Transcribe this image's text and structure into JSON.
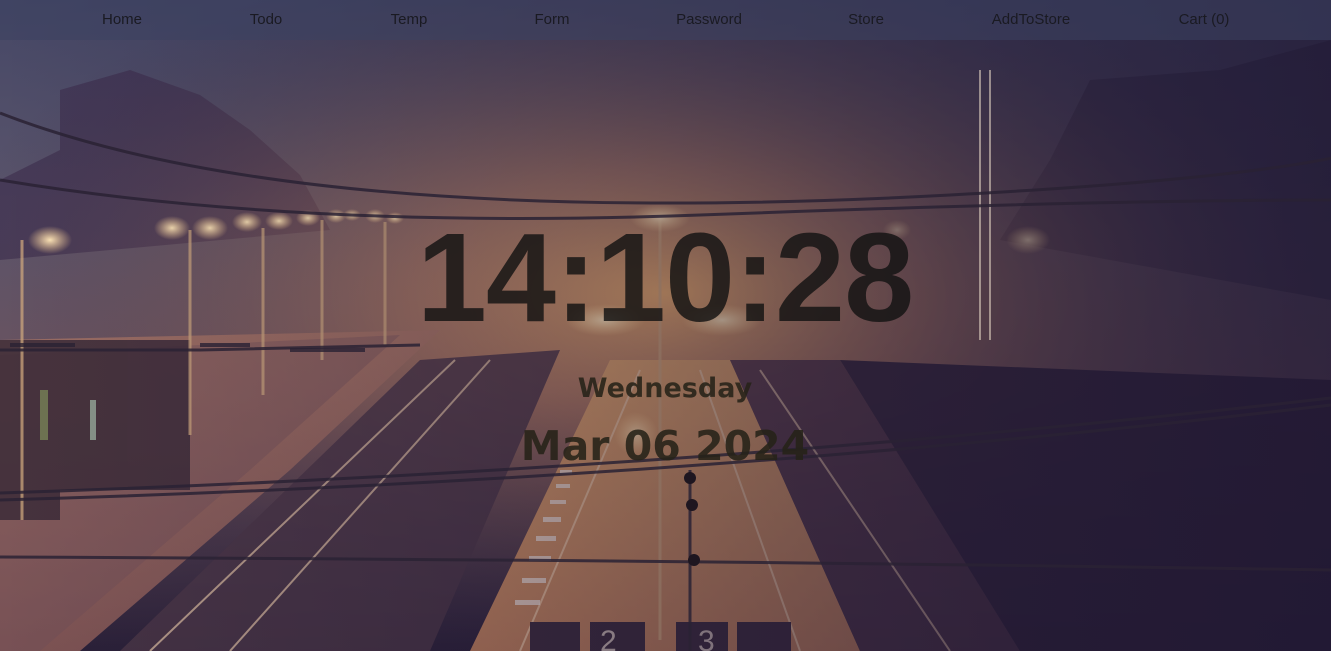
{
  "navbar": {
    "items": [
      {
        "label": "Home"
      },
      {
        "label": "Todo"
      },
      {
        "label": "Temp"
      },
      {
        "label": "Form"
      },
      {
        "label": "Password"
      },
      {
        "label": "Store"
      },
      {
        "label": "AddToStore"
      },
      {
        "label": "Cart (0)"
      }
    ]
  },
  "clock": {
    "time": "14:10:28",
    "weekday": "Wednesday",
    "date": "Mar 06 2024"
  },
  "background": {
    "scene": "foggy train station at night",
    "colors": {
      "sky": "#4a4a68",
      "glow": "#e0a060",
      "platform": "#c88e62",
      "dark": "#221a36"
    }
  }
}
